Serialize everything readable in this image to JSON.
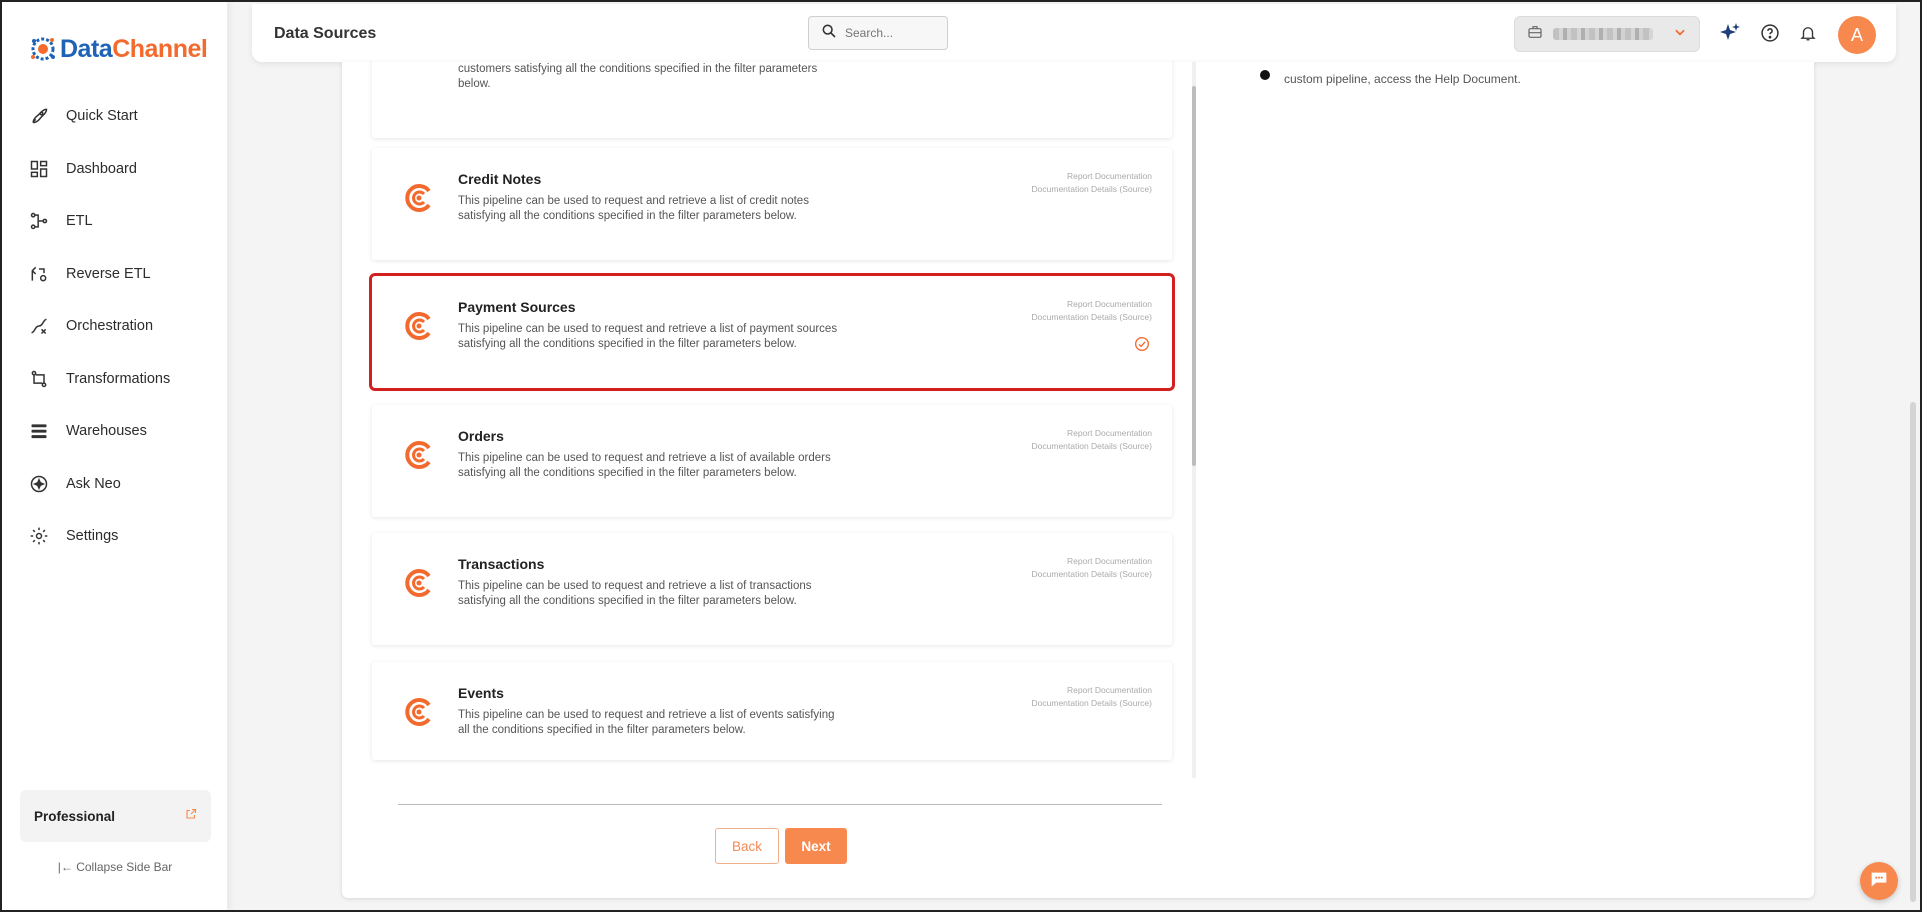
{
  "app": {
    "logo_text_prefix": "Data",
    "logo_text_suffix": "Channel",
    "brand_colors": {
      "blue": "#1e63b6",
      "orange": "#f26a2e"
    }
  },
  "sidebar": {
    "items": [
      {
        "label": "Quick Start",
        "icon": "rocket-icon"
      },
      {
        "label": "Dashboard",
        "icon": "dashboard-grid-icon"
      },
      {
        "label": "ETL",
        "icon": "etl-flow-icon"
      },
      {
        "label": "Reverse ETL",
        "icon": "reverse-etl-icon"
      },
      {
        "label": "Orchestration",
        "icon": "orchestration-icon"
      },
      {
        "label": "Transformations",
        "icon": "transformations-icon"
      },
      {
        "label": "Warehouses",
        "icon": "warehouses-stack-icon"
      },
      {
        "label": "Ask Neo",
        "icon": "sparkle-icon"
      },
      {
        "label": "Settings",
        "icon": "gear-icon"
      }
    ],
    "plan_label": "Professional",
    "collapse_label": "Collapse Side Bar"
  },
  "header": {
    "title": "Data Sources",
    "search_placeholder": "Search..."
  },
  "content": {
    "top_partial_desc": "customers satisfying all the conditions specified in the filter parameters below.",
    "right_note": "custom pipeline, access the Help Document.",
    "link_report": "Report Documentation",
    "link_details": "Documentation Details (Source)",
    "pipelines": [
      {
        "title": "Credit Notes",
        "desc": "This pipeline can be used to request and retrieve a list of credit notes satisfying all the conditions specified in the filter parameters below."
      },
      {
        "title": "Payment Sources",
        "desc": "This pipeline can be used to request and retrieve a list of payment sources satisfying all the conditions specified in the filter parameters below."
      },
      {
        "title": "Orders",
        "desc": "This pipeline can be used to request and retrieve a list of available orders satisfying all the conditions specified in the filter parameters below."
      },
      {
        "title": "Transactions",
        "desc": "This pipeline can be used to request and retrieve a list of transactions satisfying all the conditions specified in the filter parameters below."
      },
      {
        "title": "Events",
        "desc": "This pipeline can be used to request and retrieve a list of events satisfying all the conditions specified in the filter parameters below."
      }
    ],
    "back_label": "Back",
    "next_label": "Next"
  },
  "colors": {
    "accent": "#f7894f",
    "selection_outline": "#d41f1f"
  }
}
